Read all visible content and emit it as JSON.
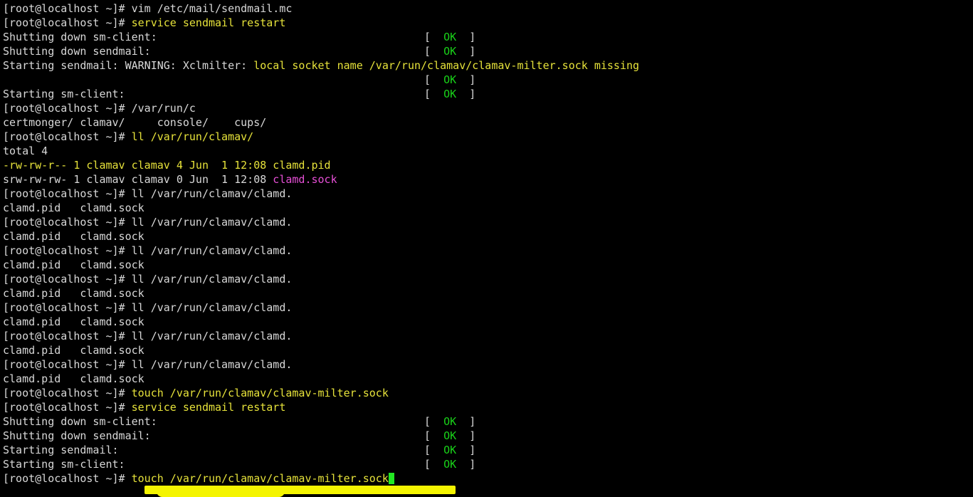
{
  "terminal": {
    "colors": {
      "background": "#000000",
      "default": "#d8d8d8",
      "yellow": "#e6e23a",
      "green": "#19d319",
      "magenta": "#e64fd6",
      "cursor": "#22e822",
      "highlight": "#f4f400"
    },
    "lines": [
      {
        "segments": [
          {
            "text": "[root@localhost ~]# ",
            "color": "default"
          },
          {
            "text": "vim /etc/mail/sendmail.mc",
            "color": "default"
          }
        ]
      },
      {
        "segments": [
          {
            "text": "[root@localhost ~]# ",
            "color": "default"
          },
          {
            "text": "service sendmail restart",
            "color": "yellow"
          }
        ]
      },
      {
        "segments": [
          {
            "text": "Shutting down sm-client:",
            "color": "default"
          }
        ],
        "status": "OK"
      },
      {
        "segments": [
          {
            "text": "Shutting down sendmail:",
            "color": "default"
          }
        ],
        "status": "OK"
      },
      {
        "segments": [
          {
            "text": "Starting sendmail: WARNING: Xclmilter: ",
            "color": "default"
          },
          {
            "text": "local socket name /var/run/clamav/clamav-milter.sock missing",
            "color": "yellow"
          }
        ]
      },
      {
        "segments": [],
        "status": "OK"
      },
      {
        "segments": [
          {
            "text": "Starting sm-client:",
            "color": "default"
          }
        ],
        "status": "OK"
      },
      {
        "segments": [
          {
            "text": "[root@localhost ~]# ",
            "color": "default"
          },
          {
            "text": "/var/run/c",
            "color": "default"
          }
        ]
      },
      {
        "segments": [
          {
            "text": "certmonger/ clamav/     console/    cups/",
            "color": "default"
          }
        ]
      },
      {
        "segments": [
          {
            "text": "[root@localhost ~]# ",
            "color": "default"
          },
          {
            "text": "ll /var/run/clamav/",
            "color": "yellow"
          }
        ]
      },
      {
        "segments": [
          {
            "text": "total 4",
            "color": "default"
          }
        ]
      },
      {
        "segments": [
          {
            "text": "-rw-rw-r-- 1 clamav clamav 4 Jun  1 12:08 ",
            "color": "yellow"
          },
          {
            "text": "clamd.pid",
            "color": "yellow"
          }
        ]
      },
      {
        "segments": [
          {
            "text": "srw-rw-rw- 1 clamav clamav 0 Jun  1 12:08 ",
            "color": "default"
          },
          {
            "text": "clamd.sock",
            "color": "magenta"
          }
        ]
      },
      {
        "segments": [
          {
            "text": "[root@localhost ~]# ",
            "color": "default"
          },
          {
            "text": "ll /var/run/clamav/clamd.",
            "color": "default"
          }
        ]
      },
      {
        "segments": [
          {
            "text": "clamd.pid   clamd.sock",
            "color": "default"
          }
        ]
      },
      {
        "segments": [
          {
            "text": "[root@localhost ~]# ",
            "color": "default"
          },
          {
            "text": "ll /var/run/clamav/clamd.",
            "color": "default"
          }
        ]
      },
      {
        "segments": [
          {
            "text": "clamd.pid   clamd.sock",
            "color": "default"
          }
        ]
      },
      {
        "segments": [
          {
            "text": "[root@localhost ~]# ",
            "color": "default"
          },
          {
            "text": "ll /var/run/clamav/clamd.",
            "color": "default"
          }
        ]
      },
      {
        "segments": [
          {
            "text": "clamd.pid   clamd.sock",
            "color": "default"
          }
        ]
      },
      {
        "segments": [
          {
            "text": "[root@localhost ~]# ",
            "color": "default"
          },
          {
            "text": "ll /var/run/clamav/clamd.",
            "color": "default"
          }
        ]
      },
      {
        "segments": [
          {
            "text": "clamd.pid   clamd.sock",
            "color": "default"
          }
        ]
      },
      {
        "segments": [
          {
            "text": "[root@localhost ~]# ",
            "color": "default"
          },
          {
            "text": "ll /var/run/clamav/clamd.",
            "color": "default"
          }
        ]
      },
      {
        "segments": [
          {
            "text": "clamd.pid   clamd.sock",
            "color": "default"
          }
        ]
      },
      {
        "segments": [
          {
            "text": "[root@localhost ~]# ",
            "color": "default"
          },
          {
            "text": "ll /var/run/clamav/clamd.",
            "color": "default"
          }
        ]
      },
      {
        "segments": [
          {
            "text": "clamd.pid   clamd.sock",
            "color": "default"
          }
        ]
      },
      {
        "segments": [
          {
            "text": "[root@localhost ~]# ",
            "color": "default"
          },
          {
            "text": "ll /var/run/clamav/clamd.",
            "color": "default"
          }
        ]
      },
      {
        "segments": [
          {
            "text": "clamd.pid   clamd.sock",
            "color": "default"
          }
        ]
      },
      {
        "segments": [
          {
            "text": "[root@localhost ~]# ",
            "color": "default"
          },
          {
            "text": "touch /var/run/clamav/clamav-milter.sock",
            "color": "yellow"
          }
        ]
      },
      {
        "segments": [
          {
            "text": "[root@localhost ~]# ",
            "color": "default"
          },
          {
            "text": "service sendmail restart",
            "color": "yellow"
          }
        ]
      },
      {
        "segments": [
          {
            "text": "Shutting down sm-client:",
            "color": "default"
          }
        ],
        "status": "OK"
      },
      {
        "segments": [
          {
            "text": "Shutting down sendmail:",
            "color": "default"
          }
        ],
        "status": "OK"
      },
      {
        "segments": [
          {
            "text": "Starting sendmail:",
            "color": "default"
          }
        ],
        "status": "OK"
      },
      {
        "segments": [
          {
            "text": "Starting sm-client:",
            "color": "default"
          }
        ],
        "status": "OK"
      },
      {
        "segments": [
          {
            "text": "[root@localhost ~]# ",
            "color": "default"
          },
          {
            "text": "touch /var/run/clamav/clamav-milter.sock",
            "color": "yellow"
          }
        ],
        "cursor": true,
        "highlighted": true
      }
    ]
  }
}
